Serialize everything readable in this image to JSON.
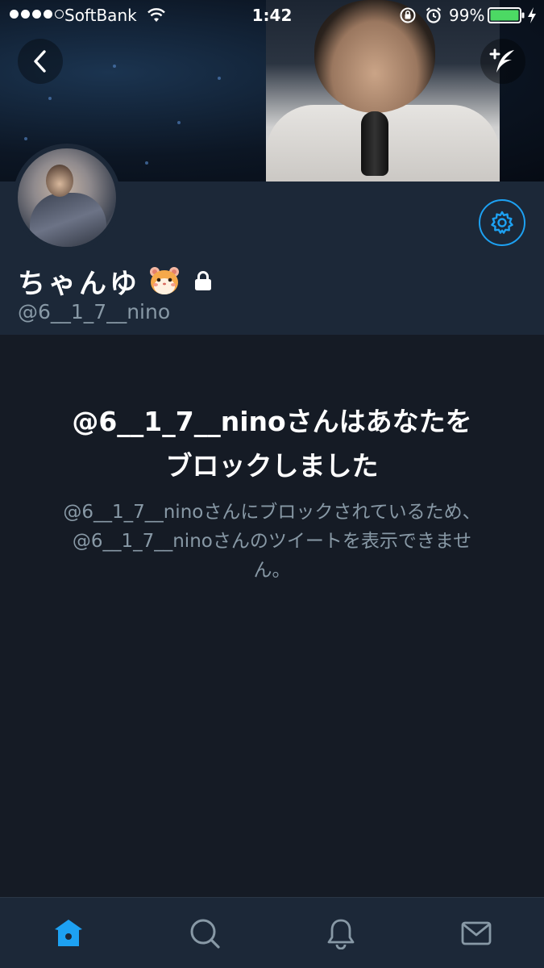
{
  "status_bar": {
    "carrier": "SoftBank",
    "time": "1:42",
    "battery_percent": "99%"
  },
  "profile": {
    "display_name": "ちゃんゆ",
    "handle": "@6__1_7__nino"
  },
  "blocked": {
    "title_line1": "@6__1_7__ninoさんはあなたを",
    "title_line2": "ブロックしました",
    "description_line1": "@6__1_7__ninoさんにブロックされているため、",
    "description_line2": "@6__1_7__ninoさんのツイートを表示できませ",
    "description_line3": "ん。"
  },
  "tabs": [
    {
      "icon": "home-icon",
      "active": true
    },
    {
      "icon": "search-icon",
      "active": false
    },
    {
      "icon": "notifications-icon",
      "active": false
    },
    {
      "icon": "messages-icon",
      "active": false
    }
  ],
  "colors": {
    "accent": "#1da1f2",
    "background": "#151b25",
    "panel": "#1c2838",
    "secondary_text": "#8899a6"
  }
}
